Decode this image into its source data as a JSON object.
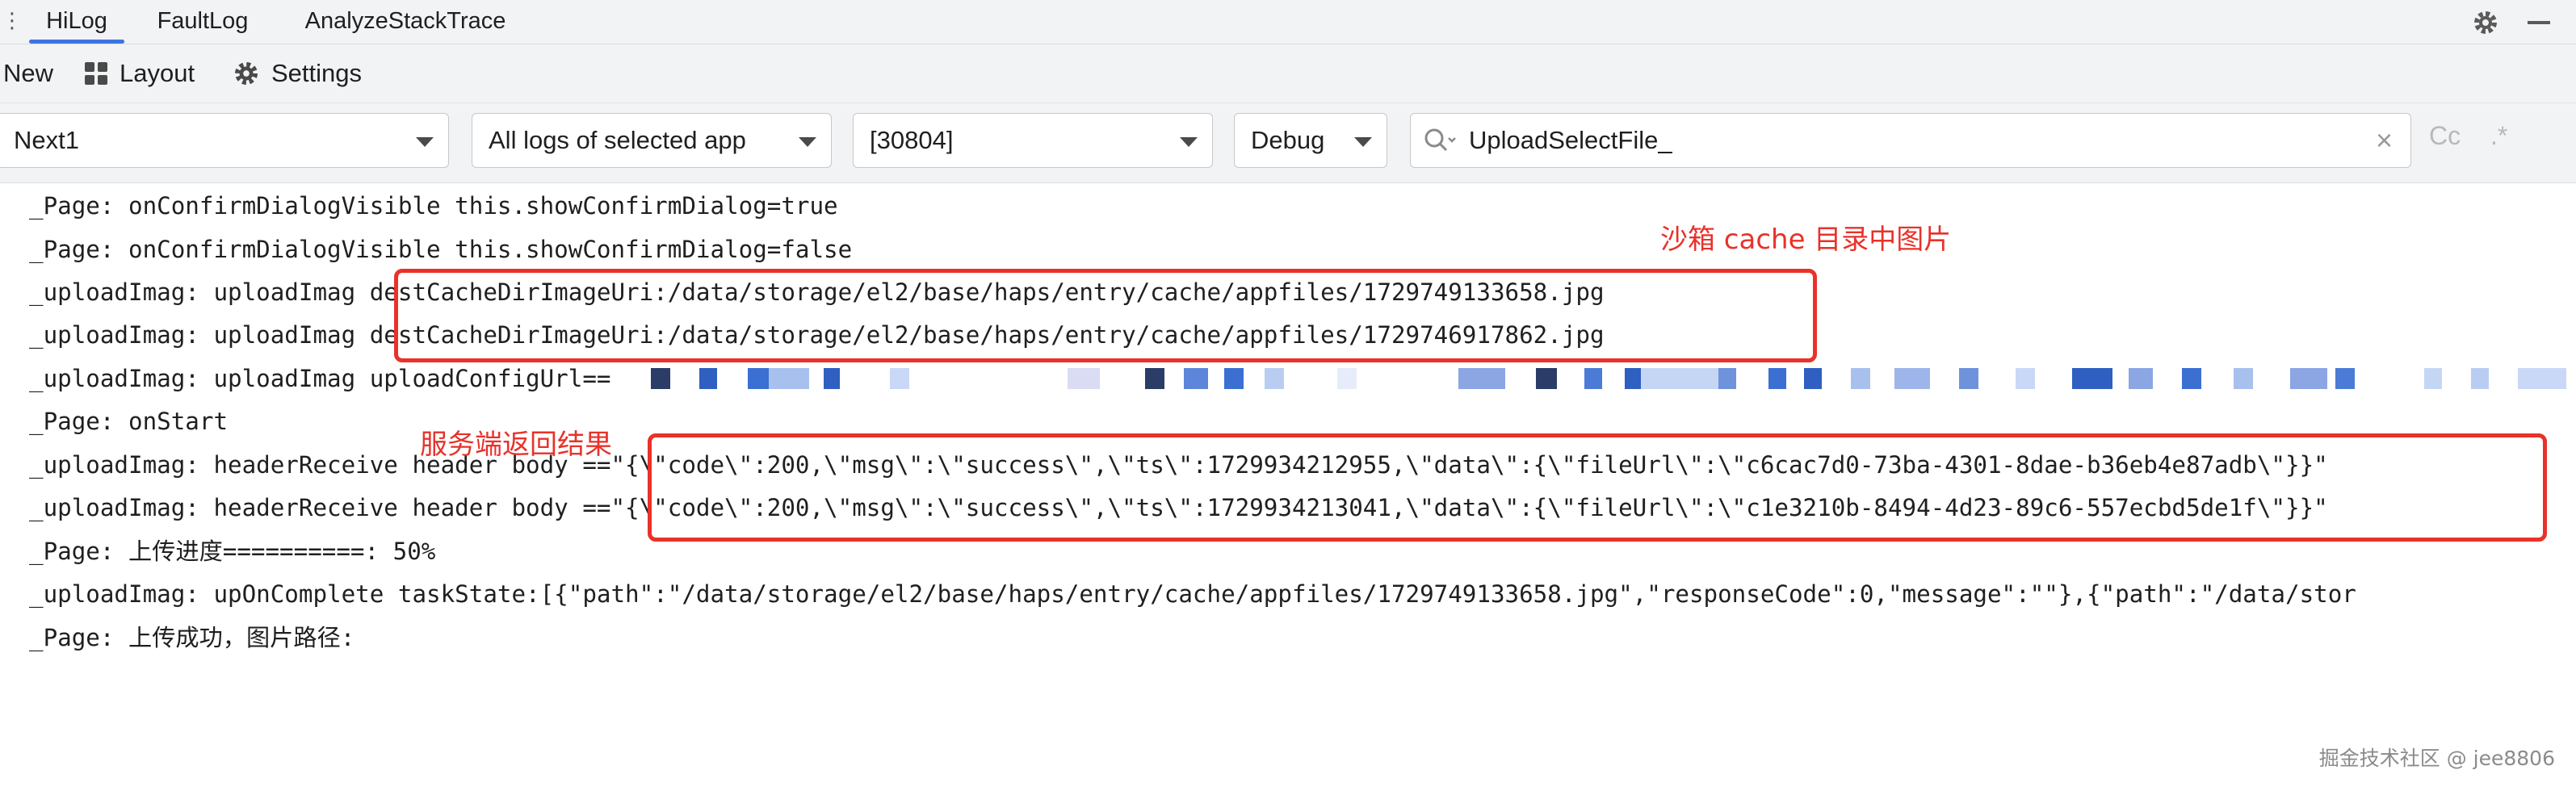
{
  "tabs": [
    {
      "label": "HiLog",
      "active": true
    },
    {
      "label": "FaultLog",
      "active": false
    },
    {
      "label": "AnalyzeStackTrace",
      "active": false
    }
  ],
  "tab_edge": "⋮",
  "tab_icons": [
    "gear-icon",
    "minimize-icon"
  ],
  "toolbar": {
    "new_label": "New",
    "layout_label": "Layout",
    "settings_label": "Settings"
  },
  "filters": {
    "device": "Next1",
    "log_scope": "All logs of selected app",
    "process": "[30804]",
    "level": "Debug",
    "search_value": "UploadSelectFile_",
    "match_case_label": "Cc",
    "regex_label": ".*"
  },
  "log_lines": [
    "_Page: onConfirmDialogVisible this.showConfirmDialog=true",
    "_Page: onConfirmDialogVisible this.showConfirmDialog=false",
    "_uploadImag: uploadImag destCacheDirImageUri:/data/storage/el2/base/haps/entry/cache/appfiles/1729749133658.jpg",
    "_uploadImag: uploadImag destCacheDirImageUri:/data/storage/el2/base/haps/entry/cache/appfiles/1729746917862.jpg",
    "_uploadImag: uploadImag uploadConfigUrl==",
    "_Page: onStart",
    "_uploadImag: headerReceive header body ==\"{\\\"code\\\":200,\\\"msg\\\":\\\"success\\\",\\\"ts\\\":1729934212955,\\\"data\\\":{\\\"fileUrl\\\":\\\"c6cac7d0-73ba-4301-8dae-b36eb4e87adb\\\"}}\"",
    "_uploadImag: headerReceive header body ==\"{\\\"code\\\":200,\\\"msg\\\":\\\"success\\\",\\\"ts\\\":1729934213041,\\\"data\\\":{\\\"fileUrl\\\":\\\"c1e3210b-8494-4d23-89c6-557ecbd5de1f\\\"}}\"",
    "_Page: 上传进度==========: 50%",
    "_uploadImag: upOnComplete taskState:[{\"path\":\"/data/storage/el2/base/haps/entry/cache/appfiles/1729749133658.jpg\",\"responseCode\":0,\"message\":\"\"},{\"path\":\"/data/stor",
    "_Page: 上传成功，图片路径:"
  ],
  "annotations": {
    "sandbox_note": "沙箱 cache 目录中图片",
    "server_note": "服务端返回结果"
  },
  "colors": {
    "annotation_red": "#e8322a",
    "tab_accent": "#3f73e0",
    "redaction_blue": "#3b6fd1"
  },
  "watermark": "掘金技术社区 @ jee8806"
}
